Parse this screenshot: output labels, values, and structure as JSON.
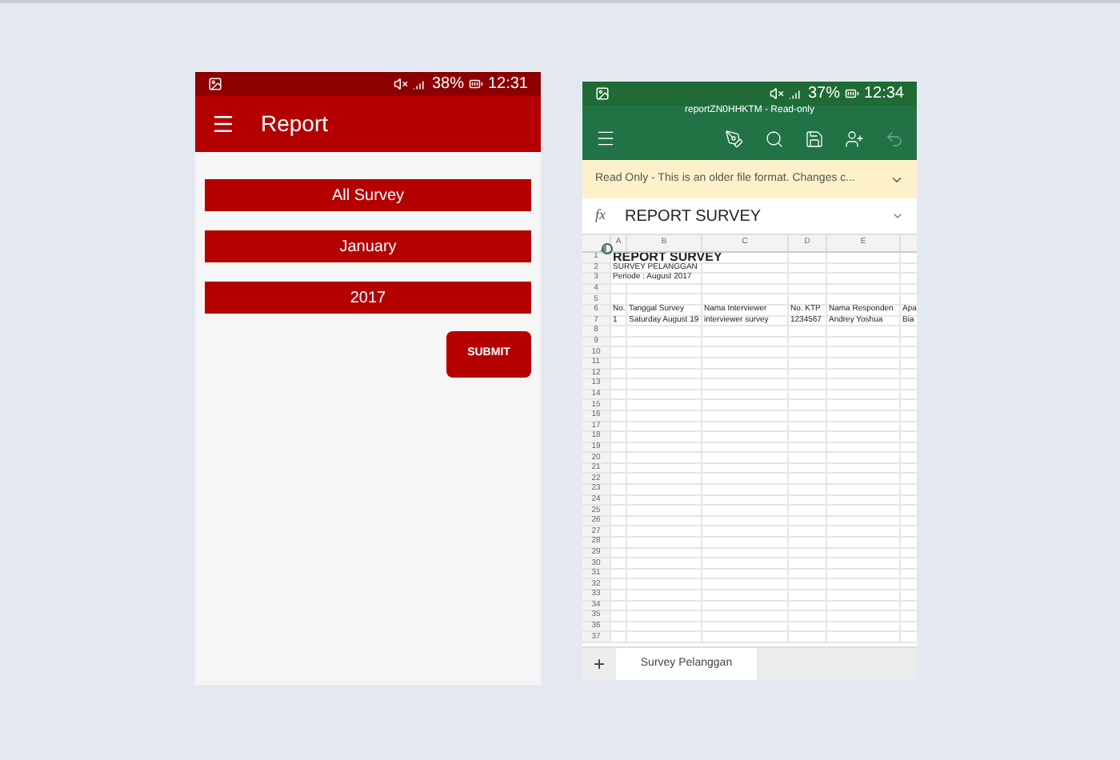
{
  "left_phone": {
    "status_bar": {
      "battery": "38%",
      "time": "12:31"
    },
    "app_bar": {
      "title": "Report"
    },
    "selectors": [
      "All Survey",
      "January",
      "2017"
    ],
    "submit_button": "SUBMIT"
  },
  "right_phone": {
    "status_bar": {
      "battery": "37%",
      "time": "12:34"
    },
    "title": "reportZN0HHKTM - Read-only",
    "banner": {
      "text": "Read Only - This is an older file format. Changes c..."
    },
    "formula_bar": {
      "fx": "fx",
      "value": "REPORT SURVEY"
    },
    "column_headers": [
      "A",
      "B",
      "C",
      "D",
      "E"
    ],
    "rows": [
      {
        "number": "1",
        "cells": {
          "a": "REPORT SURVEY"
        }
      },
      {
        "number": "2",
        "cells": {
          "a": "SURVEY PELANGGAN"
        }
      },
      {
        "number": "3",
        "cells": {
          "a": "Periode : August 2017"
        }
      },
      {
        "number": "4"
      },
      {
        "number": "5"
      },
      {
        "number": "6",
        "cells": {
          "a": "No.",
          "b": "Tanggal Survey",
          "c": "Nama Interviewer",
          "d": "No. KTP",
          "e": "Nama Responden",
          "f": "Apa"
        }
      },
      {
        "number": "7",
        "cells": {
          "a": "1",
          "b": "Saturday August 19",
          "c": "interviewer survey",
          "d": "1234567",
          "e": "Andrey Yoshua",
          "f": "Bia"
        }
      },
      {
        "number": "8"
      },
      {
        "number": "9"
      },
      {
        "number": "10"
      },
      {
        "number": "11"
      },
      {
        "number": "12"
      },
      {
        "number": "13"
      },
      {
        "number": "14"
      },
      {
        "number": "15"
      },
      {
        "number": "16"
      },
      {
        "number": "17"
      },
      {
        "number": "18"
      },
      {
        "number": "19"
      },
      {
        "number": "20"
      },
      {
        "number": "21"
      },
      {
        "number": "22"
      },
      {
        "number": "23"
      },
      {
        "number": "24"
      },
      {
        "number": "25"
      },
      {
        "number": "26"
      },
      {
        "number": "27"
      },
      {
        "number": "28"
      },
      {
        "number": "29"
      },
      {
        "number": "30"
      },
      {
        "number": "31"
      },
      {
        "number": "32"
      },
      {
        "number": "33"
      },
      {
        "number": "34"
      },
      {
        "number": "35"
      },
      {
        "number": "36"
      },
      {
        "number": "37"
      }
    ],
    "add_sheet": "+",
    "sheet_tabs": [
      {
        "label": "Survey Pelanggan",
        "selected": true
      }
    ]
  }
}
